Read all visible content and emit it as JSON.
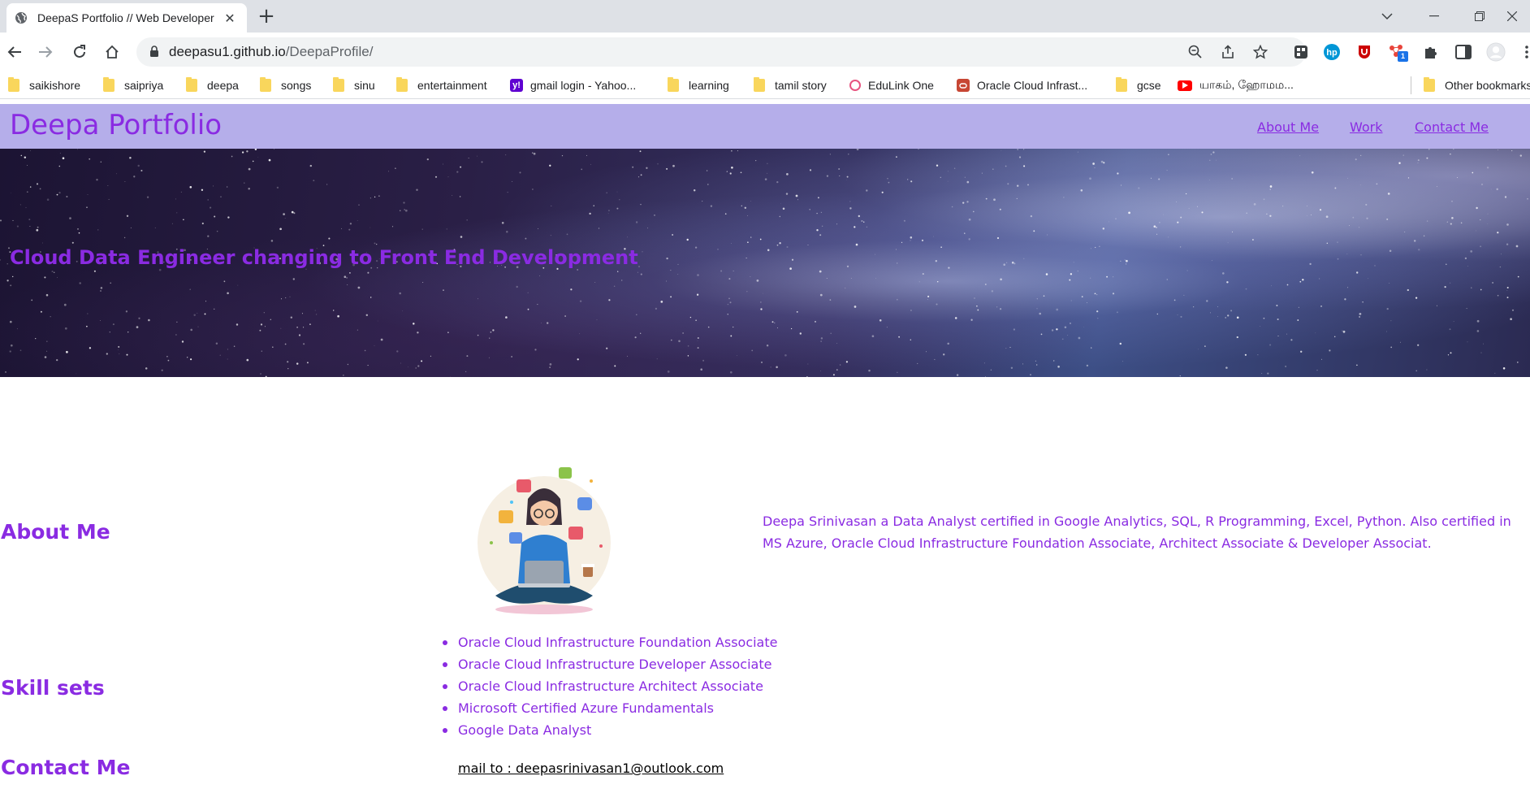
{
  "browser": {
    "tab_title": "DeepaS Portfolio // Web Developer",
    "url_host": "deepasu1.github.io",
    "url_path": "/DeepaProfile/",
    "extension_badge": "1",
    "bookmarks": [
      {
        "label": "saikishore",
        "icon": "folder-icon"
      },
      {
        "label": "saipriya",
        "icon": "folder-icon"
      },
      {
        "label": "deepa",
        "icon": "folder-icon"
      },
      {
        "label": "songs",
        "icon": "folder-icon"
      },
      {
        "label": "sinu",
        "icon": "folder-icon"
      },
      {
        "label": "entertainment",
        "icon": "folder-icon"
      },
      {
        "label": "gmail login - Yahoo...",
        "icon": "yahoo-icon"
      },
      {
        "label": "learning",
        "icon": "folder-icon"
      },
      {
        "label": "tamil story",
        "icon": "folder-icon"
      },
      {
        "label": "EduLink One",
        "icon": "edulink-icon"
      },
      {
        "label": "Oracle Cloud Infrast...",
        "icon": "oracle-icon"
      },
      {
        "label": "gcse",
        "icon": "folder-icon"
      },
      {
        "label": "யாகம், ஹோமம...",
        "icon": "youtube-icon"
      }
    ],
    "other_bookmarks": "Other bookmarks"
  },
  "site": {
    "brand": "Deepa Portfolio",
    "nav": [
      "About Me",
      "Work",
      "Contact Me"
    ],
    "tagline": "Cloud Data Engineer changing to Front End Development"
  },
  "about": {
    "title": "About Me",
    "text": "Deepa Srinivasan a Data Analyst certified in Google Analytics, SQL, R Programming, Excel, Python. Also certified in MS Azure, Oracle Cloud Infrastructure Foundation Associate, Architect Associate & Developer Associat."
  },
  "skills": {
    "title": "Skill sets",
    "items": [
      "Oracle Cloud Infrastructure Foundation Associate",
      "Oracle Cloud Infrastructure Developer Associate",
      "Oracle Cloud Infrastructure Architect Associate",
      "Microsoft Certified Azure Fundamentals",
      "Google Data Analyst"
    ]
  },
  "contact": {
    "title": "Contact Me",
    "mail": "mail to : deepasrinivasan1@outlook.com"
  },
  "colors": {
    "accent": "#8a2be2",
    "header_bg": "#b5aeea"
  }
}
